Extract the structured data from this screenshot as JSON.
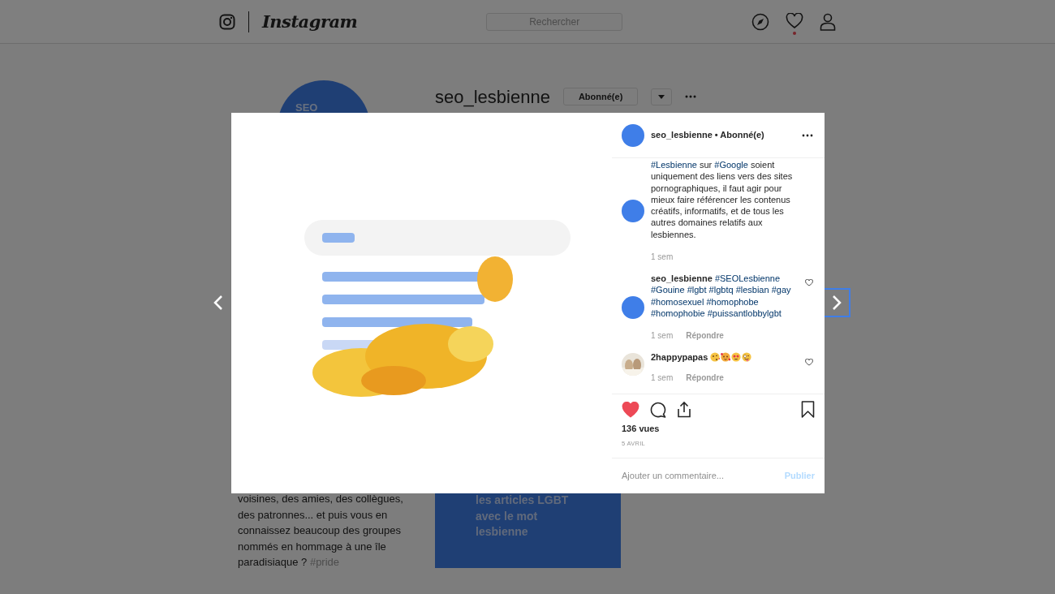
{
  "header": {
    "logo_text": "Instagram",
    "search": {
      "placeholder": "Rechercher"
    },
    "notification_dot": true
  },
  "profile": {
    "avatar_text": "SEO",
    "username": "seo_lesbienne",
    "follow_button": "Abonné(e)"
  },
  "background_posts": {
    "caption": "voisines, des amies, des collègues, des patronnes... et puis vous en connaissez beaucoup des groupes nommés en hommage à une île paradisiaque ?",
    "caption_hashtag": "#pride",
    "tile_lines": [
      "les articles LGBT",
      "avec le mot",
      "lesbienne"
    ]
  },
  "nav": [
    {
      "kind": "previous",
      "focused": false
    },
    {
      "kind": "next",
      "focused": true
    }
  ],
  "post": {
    "author": "seo_lesbienne",
    "separator": "•",
    "follow_state": "Abonné(e)",
    "comments": [
      {
        "avatar": {
          "kind": "brand"
        },
        "segments": [
          {
            "kind": "hashtag",
            "text": "#Lesbienne"
          },
          {
            "kind": "text",
            "text": " sur "
          },
          {
            "kind": "hashtag",
            "text": "#Google"
          },
          {
            "kind": "text",
            "text": " soient uniquement des liens vers des sites pornographiques, il faut agir pour mieux faire référencer les contenus créatifs, informatifs, et de tous les autres domaines relatifs aux lesbiennes."
          }
        ],
        "time": "1 sem"
      },
      {
        "avatar": {
          "kind": "brand"
        },
        "username": "seo_lesbienne",
        "segments": [
          {
            "kind": "hashtag",
            "text": "#SEOLesbienne"
          },
          {
            "kind": "hashtag",
            "text": "#Gouine"
          },
          {
            "kind": "hashtag",
            "text": "#lgbt"
          },
          {
            "kind": "hashtag",
            "text": "#lgbtq"
          },
          {
            "kind": "hashtag",
            "text": "#lesbian"
          },
          {
            "kind": "hashtag",
            "text": "#gay"
          },
          {
            "kind": "hashtag",
            "text": "#homosexuel"
          },
          {
            "kind": "hashtag",
            "text": "#homophobe"
          },
          {
            "kind": "hashtag",
            "text": "#homophobie"
          },
          {
            "kind": "hashtag",
            "text": "#puissantlobbylgbt"
          }
        ],
        "time": "1 sem",
        "reply": "Répondre",
        "like_button": true
      },
      {
        "username": "2happypapas",
        "emojis": [
          {
            "kind": "kiss"
          },
          {
            "kind": "hearts"
          },
          {
            "kind": "heart-eyes"
          },
          {
            "kind": "zany"
          }
        ],
        "time": "1 sem",
        "reply": "Répondre",
        "like_button": true
      }
    ],
    "liked": true,
    "views": "136 vues",
    "date": "5 AVRIL",
    "comment_field": {
      "placeholder": "Ajouter un commentaire..."
    },
    "post_button": {
      "label": "Publier",
      "disabled": true
    }
  }
}
